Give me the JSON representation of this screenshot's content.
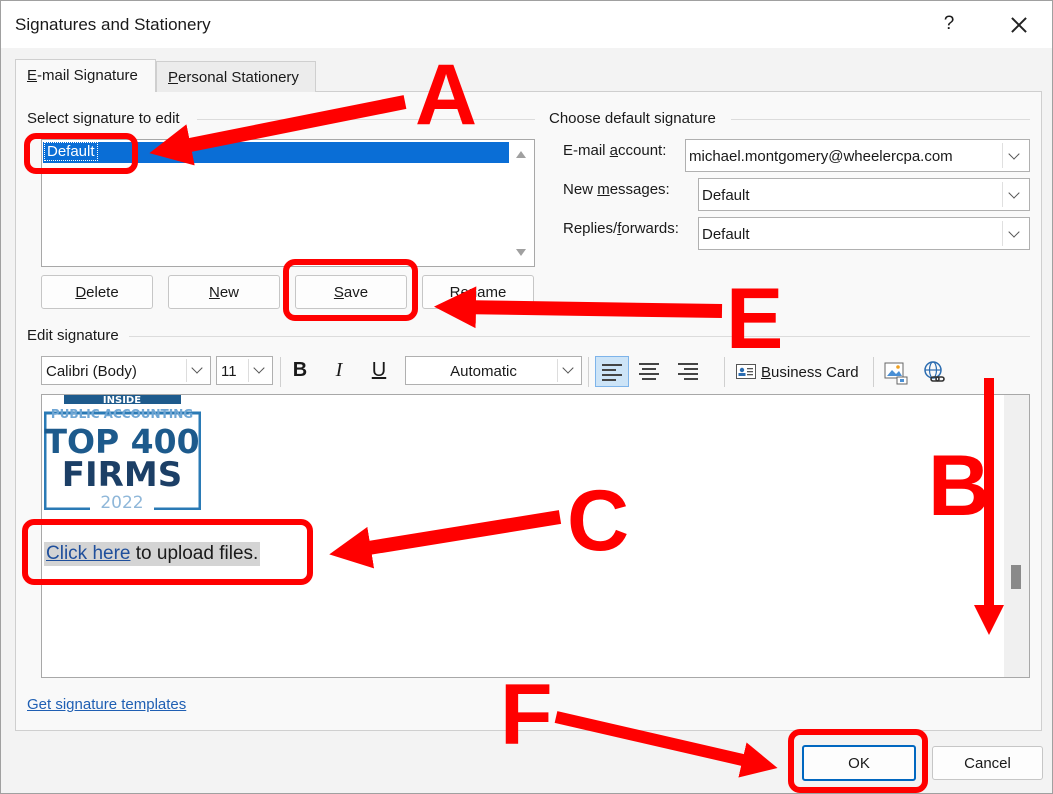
{
  "window": {
    "title": "Signatures and Stationery",
    "help": "?"
  },
  "tabs": [
    {
      "label_pre": "",
      "label_mnemonic": "E",
      "label_post": "-mail Signature",
      "active": true
    },
    {
      "label_pre": "",
      "label_mnemonic": "P",
      "label_post": "ersonal Stationery",
      "active": false
    }
  ],
  "select_signature": {
    "label": "Select signature to edit",
    "items": [
      "Default"
    ]
  },
  "signature_buttons": {
    "delete": {
      "mnemonic": "D",
      "rest": "elete"
    },
    "new": {
      "mnemonic": "N",
      "rest": "ew"
    },
    "save": {
      "mnemonic": "S",
      "rest": "ave"
    },
    "rename": {
      "label": "Rename"
    }
  },
  "default_signature": {
    "label": "Choose default signature",
    "email_account": {
      "label_pre": "E-mail ",
      "mnemonic": "a",
      "label_post": "ccount:",
      "value": "michael.montgomery@wheelercpa.com"
    },
    "new_messages": {
      "label_pre": "New ",
      "mnemonic": "m",
      "label_post": "essages:",
      "value": "Default"
    },
    "replies": {
      "label_pre": "Replies/",
      "mnemonic": "f",
      "label_post": "orwards:",
      "value": "Default"
    }
  },
  "edit_signature": {
    "label": "Edit signature",
    "font": "Calibri (Body)",
    "size": "11",
    "bold": "B",
    "italic": "I",
    "underline": "U",
    "color": "Automatic",
    "business_card": {
      "mnemonic": "B",
      "rest": "usiness Card"
    }
  },
  "signature_content": {
    "logo_lines": [
      "INSIDE",
      "PUBLIC ACCOUNTING",
      "TOP 400",
      "FIRMS",
      "2022"
    ],
    "link_text": "Click here",
    "after_link": " to upload files."
  },
  "footer": {
    "templates_link": "Get signature templates",
    "ok": "OK",
    "cancel": "Cancel"
  },
  "annotations": {
    "letters": [
      "A",
      "B",
      "C",
      "E",
      "F"
    ],
    "color": "#ff0000"
  }
}
